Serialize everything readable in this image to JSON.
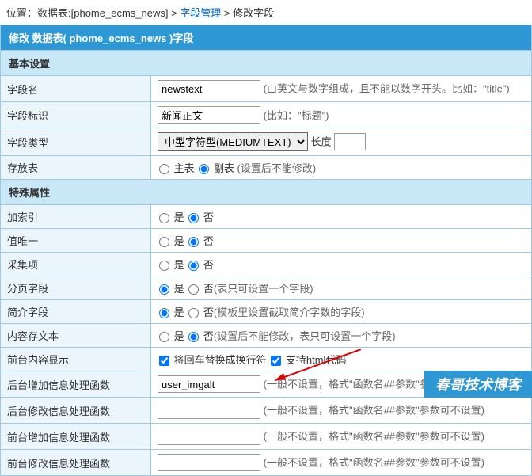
{
  "breadcrumb": {
    "prefix": "位置：",
    "part1": "数据表:[phome_ecms_news]",
    "sep": " > ",
    "link1": "字段管理",
    "part3": "修改字段"
  },
  "header": "修改 数据表( phome_ecms_news )字段",
  "sections": {
    "basic": "基本设置",
    "special": "特殊属性"
  },
  "rows": {
    "fieldName": {
      "label": "字段名",
      "value": "newstext",
      "hint": "(由英文与数字组成，且不能以数字开头。比如：\"title\")"
    },
    "fieldMark": {
      "label": "字段标识",
      "value": "新闻正文",
      "hint": "(比如：\"标题\")"
    },
    "fieldType": {
      "label": "字段类型",
      "selected": "中型字符型(MEDIUMTEXT)",
      "lenLabel": "长度",
      "lenValue": ""
    },
    "storeTable": {
      "label": "存放表",
      "opt1": "主表",
      "opt2": "副表",
      "hint": "(设置后不能修改)"
    },
    "addIndex": {
      "label": "加索引",
      "yes": "是",
      "no": "否"
    },
    "unique": {
      "label": "值唯一",
      "yes": "是",
      "no": "否"
    },
    "collect": {
      "label": "采集项",
      "yes": "是",
      "no": "否"
    },
    "paging": {
      "label": "分页字段",
      "yes": "是",
      "no": "否",
      "hint": "(表只可设置一个字段)"
    },
    "brief": {
      "label": "简介字段",
      "yes": "是",
      "no": "否",
      "hint": "(模板里设置截取简介字数的字段)"
    },
    "saveText": {
      "label": "内容存文本",
      "yes": "是",
      "no": "否",
      "hint": "(设置后不能修改，表只可设置一个字段)"
    },
    "frontShow": {
      "label": "前台内容显示",
      "opt1": "将回车替换成换行符",
      "opt2": "支持html代码"
    },
    "backAdd": {
      "label": "后台增加信息处理函数",
      "value": "user_imgalt",
      "hint": "(一般不设置，格式\"函数名##参数\"参数可不设置)"
    },
    "backEdit": {
      "label": "后台修改信息处理函数",
      "value": "",
      "hint": "(一般不设置，格式\"函数名##参数\"参数可不设置)"
    },
    "frontAdd": {
      "label": "前台增加信息处理函数",
      "value": "",
      "hint": "(一般不设置，格式\"函数名##参数\"参数可不设置)"
    },
    "frontEdit": {
      "label": "前台修改信息处理函数",
      "value": "",
      "hint": "(一般不设置，格式\"函数名##参数\"参数可不设置)"
    }
  },
  "watermark": "春哥技术博客"
}
